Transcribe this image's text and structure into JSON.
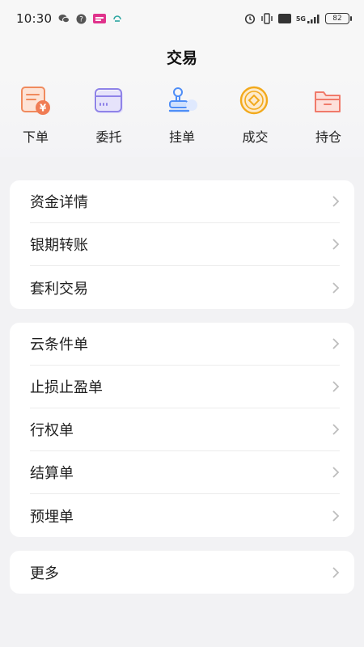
{
  "status_bar": {
    "time": "10:30",
    "network": "5G",
    "hd": "HD",
    "battery": "82"
  },
  "header": {
    "title": "交易"
  },
  "quick_actions": [
    {
      "label": "下单",
      "icon": "order-form-icon"
    },
    {
      "label": "委托",
      "icon": "entrust-card-icon"
    },
    {
      "label": "挂单",
      "icon": "stamp-icon"
    },
    {
      "label": "成交",
      "icon": "coin-icon"
    },
    {
      "label": "持仓",
      "icon": "folder-icon"
    }
  ],
  "group1": [
    {
      "label": "资金详情"
    },
    {
      "label": "银期转账"
    },
    {
      "label": "套利交易"
    }
  ],
  "group2": [
    {
      "label": "云条件单"
    },
    {
      "label": "止损止盈单"
    },
    {
      "label": "行权单"
    },
    {
      "label": "结算单"
    },
    {
      "label": "预埋单"
    }
  ],
  "group3": [
    {
      "label": "更多"
    }
  ],
  "colors": {
    "background": "#f2f2f4",
    "card": "#ffffff",
    "chevron": "#bdbdbd",
    "orange": "#f08a5d",
    "purple": "#8f83e8",
    "blue": "#4f8ef7",
    "gold": "#f2a91c",
    "coral": "#f07a6a"
  }
}
